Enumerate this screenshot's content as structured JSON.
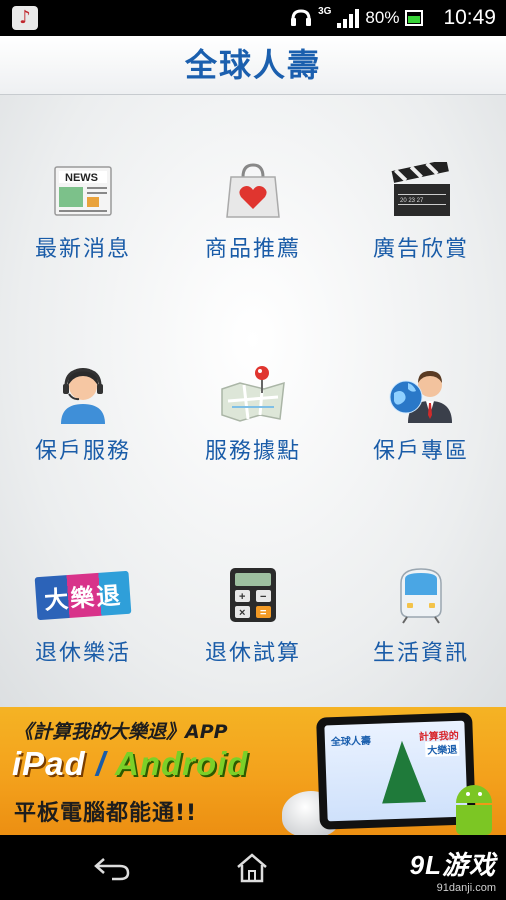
{
  "status_bar": {
    "network": "3G",
    "battery": "80%",
    "time": "10:49"
  },
  "header": {
    "title": "全球人壽"
  },
  "menu": {
    "items": [
      {
        "label": "最新消息",
        "icon": "news-icon"
      },
      {
        "label": "商品推薦",
        "icon": "shopping-bag-heart-icon"
      },
      {
        "label": "廣告欣賞",
        "icon": "clapperboard-icon"
      },
      {
        "label": "保戶服務",
        "icon": "customer-service-headset-icon"
      },
      {
        "label": "服務據點",
        "icon": "map-pin-icon"
      },
      {
        "label": "保戶專區",
        "icon": "globe-businessman-icon"
      },
      {
        "label": "退休樂活",
        "icon": "da-le-tui-badge-icon",
        "badge_text": "大樂退"
      },
      {
        "label": "退休試算",
        "icon": "calculator-icon"
      },
      {
        "label": "生活資訊",
        "icon": "train-icon"
      }
    ]
  },
  "banner": {
    "line1": "《計算我的大樂退》APP",
    "ipad": "iPad",
    "slash": " / ",
    "android": "Android",
    "line3": "平板電腦都能通!!",
    "tablet_left": "全球人壽",
    "tablet_right": "計算我的",
    "tablet_right2": "大樂退"
  },
  "nav": {
    "back_icon": "back-arrow-icon",
    "home_icon": "home-icon"
  },
  "watermark": {
    "big": "9L游戏",
    "small": "91danji.com"
  },
  "colors": {
    "brand_blue": "#1b5fae",
    "banner_orange": "#f3a11c",
    "android_green": "#7cc624"
  }
}
